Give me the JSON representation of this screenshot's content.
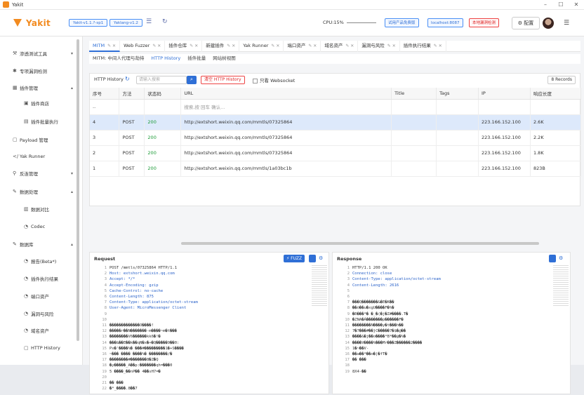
{
  "window": {
    "title": "Yakit"
  },
  "header": {
    "app_name": "Yakit",
    "badges": [
      "Yakit-v1.1.?-sp1",
      "Yaklang-v1.2"
    ],
    "cpu": "CPU:15%",
    "buttons": [
      "试用产品免费版",
      "localhost:8087"
    ],
    "alert": "本地漏洞检测",
    "config": "配置"
  },
  "sidebar": {
    "items": [
      {
        "label": "渗透测试工具",
        "icon": "tool-icon",
        "child": false
      },
      {
        "label": "专项漏洞检测",
        "icon": "bug-icon",
        "child": false
      },
      {
        "label": "插件管理",
        "icon": "grid-icon",
        "child": false
      },
      {
        "label": "插件商店",
        "icon": "store-icon",
        "child": true
      },
      {
        "label": "插件批量执行",
        "icon": "batch-icon",
        "child": true
      },
      {
        "label": "Payload 管理",
        "icon": "payload-icon",
        "child": false
      },
      {
        "label": "Yak Runner",
        "icon": "code-icon",
        "child": false
      },
      {
        "label": "反连管理",
        "icon": "link-icon",
        "child": false
      },
      {
        "label": "数据处理",
        "icon": "data-icon",
        "child": false
      },
      {
        "label": "数据对比",
        "icon": "compare-icon",
        "child": true
      },
      {
        "label": "Codec",
        "icon": "codec-icon",
        "child": true
      },
      {
        "label": "数据库",
        "icon": "database-icon",
        "child": false
      },
      {
        "label": "报告(Beta*)",
        "icon": "report-icon",
        "child": true
      },
      {
        "label": "插件执行结果",
        "icon": "result-icon",
        "child": true
      },
      {
        "label": "端口资产",
        "icon": "port-icon",
        "child": true
      },
      {
        "label": "漏洞与风险",
        "icon": "risk-icon",
        "child": true
      },
      {
        "label": "域名资产",
        "icon": "domain-icon",
        "child": true
      },
      {
        "label": "HTTP History",
        "icon": "history-icon",
        "child": true
      }
    ]
  },
  "tabs_top": [
    "MITM",
    "Web Fuzzer",
    "插件仓库",
    "新建插件",
    "Yak Runner",
    "端口资产",
    "域名资产",
    "漏洞与风险",
    "插件执行结果"
  ],
  "tabs_sub": [
    "MITM: 中间人代理与劫持",
    "HTTP History",
    "插件批量",
    "网站树视图"
  ],
  "history": {
    "label": "HTTP History",
    "search_placeholder": "请输入搜索",
    "clear": "清空 HTTP History",
    "websocket": "只看 Websocket",
    "records": "8 Records",
    "columns": [
      "序号",
      "方法",
      "状态码",
      "URL",
      "Title",
      "Tags",
      "IP",
      "响应长度"
    ],
    "filter_row": "..",
    "filter_hint": "搜索,按 回车 确认...",
    "rows": [
      {
        "id": "4",
        "method": "POST",
        "status": "200",
        "url": "http://extshort.weixin.qq.com/mmtls/07325864",
        "ip": "223.166.152.100",
        "len": "2.6K"
      },
      {
        "id": "3",
        "method": "POST",
        "status": "200",
        "url": "http://extshort.weixin.qq.com/mmtls/07325864",
        "ip": "223.166.152.100",
        "len": "2.2K"
      },
      {
        "id": "2",
        "method": "POST",
        "status": "200",
        "url": "http://extshort.weixin.qq.com/mmtls/07325864",
        "ip": "223.166.152.100",
        "len": "1.8K"
      },
      {
        "id": "1",
        "method": "POST",
        "status": "200",
        "url": "http://extshort.weixin.qq.com/mmtls/1a03bc1b",
        "ip": "223.166.152.100",
        "len": "823B"
      }
    ]
  },
  "request": {
    "title": "Request",
    "fuzz": "FUZZ",
    "lines": [
      "POST /mmtls/07325864 HTTP/1.1",
      "Host: extshort.weixin.qq.com",
      "Accept: */*",
      "Accept-Encoding: gzip",
      "Cache-Control: no-cache",
      "Content-Length: 875",
      "Content-Type: application/octet-stream",
      "User-Agent: MicroMessenger Client",
      "",
      "",
      "�������������O����!",
      "�����r��N�������-m����~m�t���",
      "��������V6������kk6�!�",
      "���&��E��k��qN�x�+�Q�����9��0:",
      "Px�'����%� ���#���������1�+S����",
      "~��� ���� ����%� ��������/�",
      "��������#�������8�Z�Q",
      "�y�����_A��p:�������qh=���0",
      "5 ����_��nP�� 4��sH7=�",
      "",
      "�� ���",
      "�*_����.8��7"
    ]
  },
  "response": {
    "title": "Response",
    "lines": [
      "HTTP/1.1 200 OK",
      "Connection: close",
      "Content-Type: application/octet-stream",
      "Content-Length: 2616",
      "",
      "",
      "���Q�������&�E�K��",
      "��ȯ��u�xgU����F�%�",
      "�Ð���*� �_�(�j�Z#����.T�",
      "�ZNA�Á�������p������F�",
      "��������N����y�t���h��",
      "7�7���#��}C�����7�$�@��",
      "����&�j��o����*B*��@�%�",
      "����V����%���Mr���Z������2����",
      "1�~��V-",
      "��a��*��o�|�fT�",
      "�� ���",
      "",
      "8X4-��"
    ]
  }
}
